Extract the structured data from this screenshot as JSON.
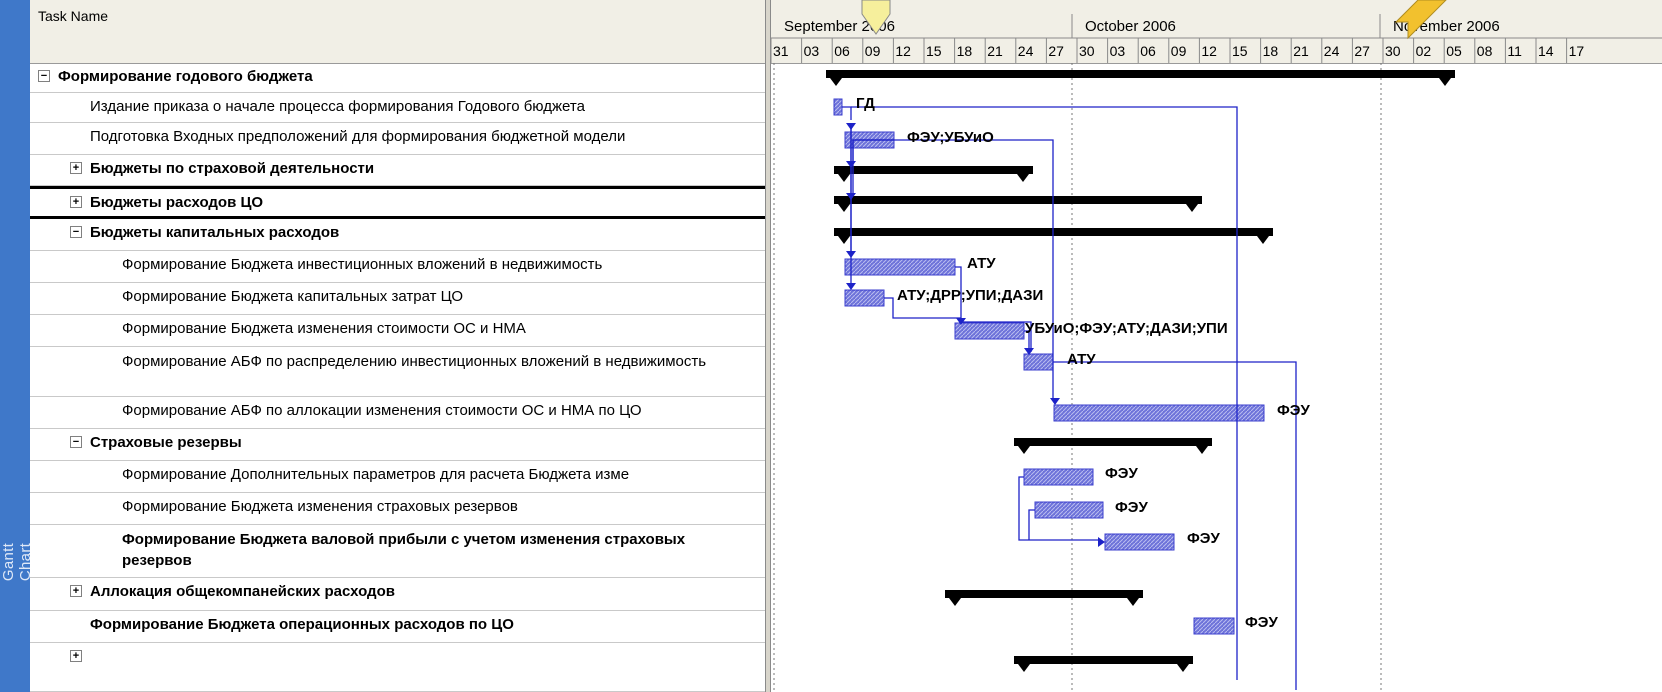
{
  "sidebar": {
    "label": "Gantt Chart"
  },
  "table": {
    "header": "Task Name",
    "rows": [
      {
        "text": "Формирование годового бюджета",
        "indent": 0,
        "toggle": "−",
        "bold": true
      },
      {
        "text": "Издание приказа о начале процесса формирования Годового бюджета",
        "indent": 1,
        "toggle": "",
        "bold": false
      },
      {
        "text": "Подготовка Входных предположений для формирования бюджетной модели",
        "indent": 1,
        "toggle": "",
        "bold": false
      },
      {
        "text": "Бюджеты по страховой деятельности",
        "indent": 1,
        "toggle": "+",
        "bold": true
      },
      {
        "text": "Бюджеты расходов ЦО",
        "indent": 1,
        "toggle": "+",
        "bold": true,
        "selected": true
      },
      {
        "text": "Бюджеты капитальных расходов",
        "indent": 1,
        "toggle": "−",
        "bold": true
      },
      {
        "text": "Формирование Бюджета инвестиционных вложений в недвижимость",
        "indent": 2,
        "toggle": "",
        "bold": false
      },
      {
        "text": "Формирование Бюджета капитальных затрат ЦО",
        "indent": 2,
        "toggle": "",
        "bold": false
      },
      {
        "text": "Формирование Бюджета изменения стоимости ОС и НМА",
        "indent": 2,
        "toggle": "",
        "bold": false
      },
      {
        "text": "Формирование АБФ по распределению инвестиционных вложений в недвижимость",
        "indent": 2,
        "toggle": "",
        "bold": false,
        "wrap": true
      },
      {
        "text": "Формирование АБФ по аллокации изменения стоимости ОС и НМА по ЦО",
        "indent": 2,
        "toggle": "",
        "bold": false
      },
      {
        "text": "Страховые резервы",
        "indent": 1,
        "toggle": "−",
        "bold": true
      },
      {
        "text": "Формирование Дополнительных параметров для расчета Бюджета изме",
        "indent": 2,
        "toggle": "",
        "bold": false
      },
      {
        "text": "Формирование Бюджета изменения страховых резервов",
        "indent": 2,
        "toggle": "",
        "bold": false
      },
      {
        "text": "Формирование Бюджета валовой прибыли с учетом изменения страховых резервов",
        "indent": 2,
        "toggle": "",
        "bold": true,
        "wrap": true
      },
      {
        "text": "Аллокация общекомпанейских расходов",
        "indent": 1,
        "toggle": "+",
        "bold": true
      },
      {
        "text": "Формирование Бюджета операционных расходов по ЦО",
        "indent": 1,
        "toggle": "",
        "bold": true
      },
      {
        "text": "",
        "indent": 1,
        "toggle": "+",
        "bold": true
      }
    ]
  },
  "timescale": {
    "months": [
      "September 2006",
      "October 2006",
      "November 2006"
    ],
    "days": [
      "31",
      "03",
      "06",
      "09",
      "12",
      "15",
      "18",
      "21",
      "24",
      "27",
      "30",
      "03",
      "06",
      "09",
      "12",
      "15",
      "18",
      "21",
      "24",
      "27",
      "30",
      "02",
      "05",
      "08",
      "11",
      "14",
      "17"
    ]
  },
  "gantt": {
    "colors": {
      "bar": "#3b3fce",
      "bar_fill": "#6d72d9",
      "summary": "#000000",
      "link": "#1d22c8",
      "callout": "#f6ef9c"
    },
    "resource_labels": [
      "ГД",
      "ФЭУ;УБУиО",
      "АТУ",
      "АТУ;ДРР;УПИ;ДАЗИ",
      "УБУиО;ФЭУ;АТУ;ДАЗИ;УПИ",
      "АТУ",
      "ФЭУ",
      "ФЭУ",
      "ФЭУ",
      "ФЭУ",
      "ФЭУ"
    ]
  }
}
